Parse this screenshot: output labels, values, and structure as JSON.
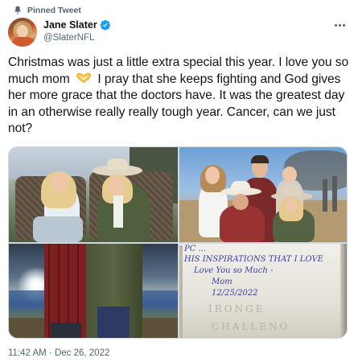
{
  "pinned_label": "Pinned Tweet",
  "author": {
    "name": "Jane Slater",
    "handle": "@SlaterNFL",
    "verified": true
  },
  "more_icon": "ellipsis-icon",
  "tweet": {
    "text_before_emoji": "Christmas was just a little extra special this year. I love you so much mom",
    "emoji": "heart-hands",
    "text_after_emoji": "I pray that she keeps fighting and God gives her more grace that the doctors have. It was the greatest day in an otherwise really really tough year. Cancer, can we just not?"
  },
  "media": {
    "photo_count": 4,
    "note_lines": [
      "PC ...",
      "HIS INSPIRATIONS THAT I LOVE",
      "Love You so Much -",
      "Mom",
      "12/25/2022"
    ],
    "note_faint": [
      "IRONGE",
      "CHALLENO"
    ]
  },
  "timestamp": "11:42 AM · Dec 26, 2022",
  "colors": {
    "text_primary": "#0f1419",
    "text_secondary": "#536471",
    "verified_blue": "#1d9bf0",
    "border": "#cfd9de",
    "heart_yellow": "#f7c948"
  }
}
